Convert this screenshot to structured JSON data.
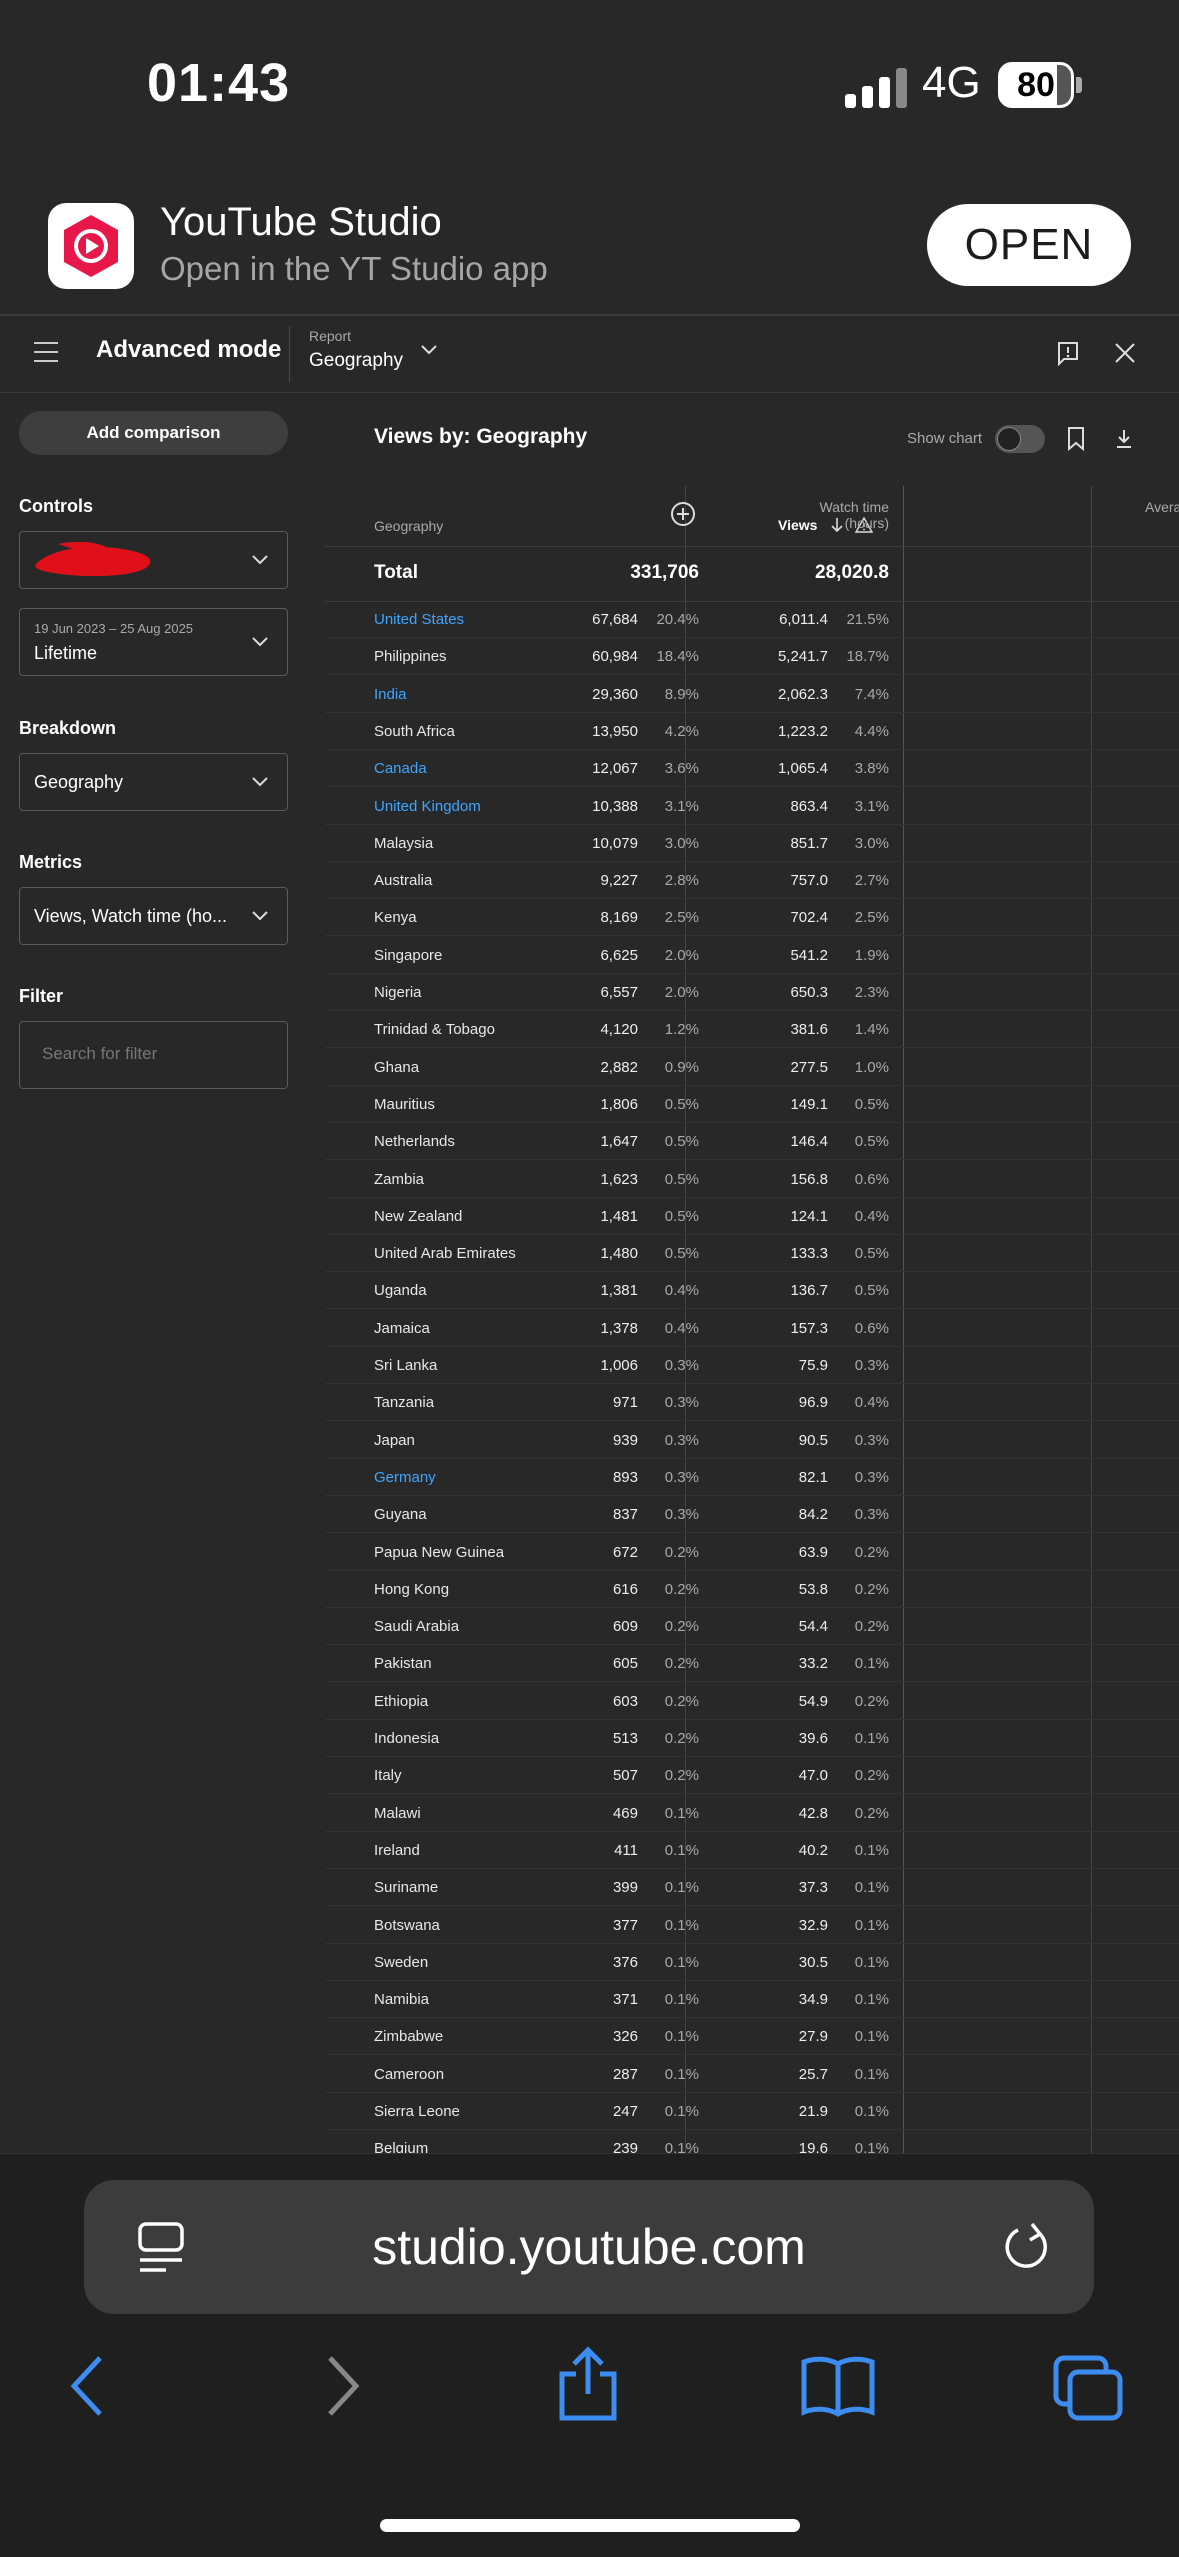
{
  "status": {
    "time": "01:43",
    "network": "4G",
    "battery": "80"
  },
  "banner": {
    "app_name": "YouTube Studio",
    "subtitle": "Open in the YT Studio app",
    "open_label": "OPEN"
  },
  "header": {
    "title": "Advanced mode",
    "report_label": "Report",
    "report_value": "Geography"
  },
  "sidebar": {
    "add_comparison": "Add comparison",
    "controls_label": "Controls",
    "date_range": "19 Jun 2023 – 25 Aug 2025",
    "date_value": "Lifetime",
    "breakdown_label": "Breakdown",
    "breakdown_value": "Geography",
    "metrics_label": "Metrics",
    "metrics_value": "Views, Watch time (ho...",
    "filter_label": "Filter",
    "filter_placeholder": "Search for filter"
  },
  "main": {
    "title": "Views by: Geography",
    "show_chart": "Show chart",
    "columns": {
      "geography": "Geography",
      "views": "Views",
      "watch_time_1": "Watch time",
      "watch_time_2": "(hours)",
      "avg": "Avera"
    },
    "total": {
      "label": "Total",
      "views": "331,706",
      "watch_time": "28,020.8"
    },
    "rows": [
      {
        "name": "United States",
        "link": true,
        "views": "67,684",
        "vp": "20.4%",
        "wt": "6,011.4",
        "wp": "21.5%"
      },
      {
        "name": "Philippines",
        "link": false,
        "views": "60,984",
        "vp": "18.4%",
        "wt": "5,241.7",
        "wp": "18.7%"
      },
      {
        "name": "India",
        "link": true,
        "views": "29,360",
        "vp": "8.9%",
        "wt": "2,062.3",
        "wp": "7.4%"
      },
      {
        "name": "South Africa",
        "link": false,
        "views": "13,950",
        "vp": "4.2%",
        "wt": "1,223.2",
        "wp": "4.4%"
      },
      {
        "name": "Canada",
        "link": true,
        "views": "12,067",
        "vp": "3.6%",
        "wt": "1,065.4",
        "wp": "3.8%"
      },
      {
        "name": "United Kingdom",
        "link": true,
        "views": "10,388",
        "vp": "3.1%",
        "wt": "863.4",
        "wp": "3.1%"
      },
      {
        "name": "Malaysia",
        "link": false,
        "views": "10,079",
        "vp": "3.0%",
        "wt": "851.7",
        "wp": "3.0%"
      },
      {
        "name": "Australia",
        "link": false,
        "views": "9,227",
        "vp": "2.8%",
        "wt": "757.0",
        "wp": "2.7%"
      },
      {
        "name": "Kenya",
        "link": false,
        "views": "8,169",
        "vp": "2.5%",
        "wt": "702.4",
        "wp": "2.5%"
      },
      {
        "name": "Singapore",
        "link": false,
        "views": "6,625",
        "vp": "2.0%",
        "wt": "541.2",
        "wp": "1.9%"
      },
      {
        "name": "Nigeria",
        "link": false,
        "views": "6,557",
        "vp": "2.0%",
        "wt": "650.3",
        "wp": "2.3%"
      },
      {
        "name": "Trinidad & Tobago",
        "link": false,
        "views": "4,120",
        "vp": "1.2%",
        "wt": "381.6",
        "wp": "1.4%"
      },
      {
        "name": "Ghana",
        "link": false,
        "views": "2,882",
        "vp": "0.9%",
        "wt": "277.5",
        "wp": "1.0%"
      },
      {
        "name": "Mauritius",
        "link": false,
        "views": "1,806",
        "vp": "0.5%",
        "wt": "149.1",
        "wp": "0.5%"
      },
      {
        "name": "Netherlands",
        "link": false,
        "views": "1,647",
        "vp": "0.5%",
        "wt": "146.4",
        "wp": "0.5%"
      },
      {
        "name": "Zambia",
        "link": false,
        "views": "1,623",
        "vp": "0.5%",
        "wt": "156.8",
        "wp": "0.6%"
      },
      {
        "name": "New Zealand",
        "link": false,
        "views": "1,481",
        "vp": "0.5%",
        "wt": "124.1",
        "wp": "0.4%"
      },
      {
        "name": "United Arab Emirates",
        "link": false,
        "views": "1,480",
        "vp": "0.5%",
        "wt": "133.3",
        "wp": "0.5%"
      },
      {
        "name": "Uganda",
        "link": false,
        "views": "1,381",
        "vp": "0.4%",
        "wt": "136.7",
        "wp": "0.5%"
      },
      {
        "name": "Jamaica",
        "link": false,
        "views": "1,378",
        "vp": "0.4%",
        "wt": "157.3",
        "wp": "0.6%"
      },
      {
        "name": "Sri Lanka",
        "link": false,
        "views": "1,006",
        "vp": "0.3%",
        "wt": "75.9",
        "wp": "0.3%"
      },
      {
        "name": "Tanzania",
        "link": false,
        "views": "971",
        "vp": "0.3%",
        "wt": "96.9",
        "wp": "0.4%"
      },
      {
        "name": "Japan",
        "link": false,
        "views": "939",
        "vp": "0.3%",
        "wt": "90.5",
        "wp": "0.3%"
      },
      {
        "name": "Germany",
        "link": true,
        "views": "893",
        "vp": "0.3%",
        "wt": "82.1",
        "wp": "0.3%"
      },
      {
        "name": "Guyana",
        "link": false,
        "views": "837",
        "vp": "0.3%",
        "wt": "84.2",
        "wp": "0.3%"
      },
      {
        "name": "Papua New Guinea",
        "link": false,
        "views": "672",
        "vp": "0.2%",
        "wt": "63.9",
        "wp": "0.2%"
      },
      {
        "name": "Hong Kong",
        "link": false,
        "views": "616",
        "vp": "0.2%",
        "wt": "53.8",
        "wp": "0.2%"
      },
      {
        "name": "Saudi Arabia",
        "link": false,
        "views": "609",
        "vp": "0.2%",
        "wt": "54.4",
        "wp": "0.2%"
      },
      {
        "name": "Pakistan",
        "link": false,
        "views": "605",
        "vp": "0.2%",
        "wt": "33.2",
        "wp": "0.1%"
      },
      {
        "name": "Ethiopia",
        "link": false,
        "views": "603",
        "vp": "0.2%",
        "wt": "54.9",
        "wp": "0.2%"
      },
      {
        "name": "Indonesia",
        "link": false,
        "views": "513",
        "vp": "0.2%",
        "wt": "39.6",
        "wp": "0.1%"
      },
      {
        "name": "Italy",
        "link": false,
        "views": "507",
        "vp": "0.2%",
        "wt": "47.0",
        "wp": "0.2%"
      },
      {
        "name": "Malawi",
        "link": false,
        "views": "469",
        "vp": "0.1%",
        "wt": "42.8",
        "wp": "0.2%"
      },
      {
        "name": "Ireland",
        "link": false,
        "views": "411",
        "vp": "0.1%",
        "wt": "40.2",
        "wp": "0.1%"
      },
      {
        "name": "Suriname",
        "link": false,
        "views": "399",
        "vp": "0.1%",
        "wt": "37.3",
        "wp": "0.1%"
      },
      {
        "name": "Botswana",
        "link": false,
        "views": "377",
        "vp": "0.1%",
        "wt": "32.9",
        "wp": "0.1%"
      },
      {
        "name": "Sweden",
        "link": false,
        "views": "376",
        "vp": "0.1%",
        "wt": "30.5",
        "wp": "0.1%"
      },
      {
        "name": "Namibia",
        "link": false,
        "views": "371",
        "vp": "0.1%",
        "wt": "34.9",
        "wp": "0.1%"
      },
      {
        "name": "Zimbabwe",
        "link": false,
        "views": "326",
        "vp": "0.1%",
        "wt": "27.9",
        "wp": "0.1%"
      },
      {
        "name": "Cameroon",
        "link": false,
        "views": "287",
        "vp": "0.1%",
        "wt": "25.7",
        "wp": "0.1%"
      },
      {
        "name": "Sierra Leone",
        "link": false,
        "views": "247",
        "vp": "0.1%",
        "wt": "21.9",
        "wp": "0.1%"
      },
      {
        "name": "Belgium",
        "link": false,
        "views": "239",
        "vp": "0.1%",
        "wt": "19.6",
        "wp": "0.1%"
      }
    ]
  },
  "browser": {
    "url": "studio.youtube.com"
  },
  "colors": {
    "background": "#282828",
    "link": "#3ea6ff",
    "brand_red": "#e8174a"
  },
  "icons": [
    "signal-icon",
    "battery-icon",
    "yt-studio-icon",
    "menu-icon",
    "chevron-down-icon",
    "feedback-icon",
    "close-icon",
    "sort-down-icon",
    "warning-icon",
    "bookmark-icon",
    "download-icon",
    "tabs-icon",
    "reload-icon",
    "back-icon",
    "forward-icon",
    "share-icon",
    "bookmarks-icon",
    "tabs-overview-icon"
  ]
}
